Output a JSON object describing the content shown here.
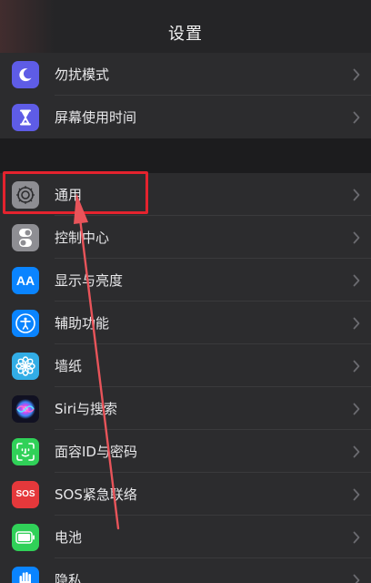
{
  "navbar": {
    "title": "设置"
  },
  "colors": {
    "accent_highlight": "#e4232e",
    "arrow": "#e8545a",
    "background": "#1c1c1e",
    "cell": "#2c2c2e"
  },
  "groups": [
    {
      "items": [
        {
          "label": "勿扰模式",
          "icon": "moon-icon",
          "icon_color": "#5e5ce6"
        },
        {
          "label": "屏幕使用时间",
          "icon": "hourglass-icon",
          "icon_color": "#5e5ce6"
        }
      ]
    },
    {
      "items": [
        {
          "label": "通用",
          "icon": "gear-icon",
          "icon_color": "#8e8e93"
        },
        {
          "label": "控制中心",
          "icon": "toggle-icon",
          "icon_color": "#8e8e93"
        },
        {
          "label": "显示与亮度",
          "icon": "text-size-icon",
          "icon_color": "#0a84ff",
          "icon_text": "AA"
        },
        {
          "label": "辅助功能",
          "icon": "accessibility-icon",
          "icon_color": "#0a84ff"
        },
        {
          "label": "墙纸",
          "icon": "flower-icon",
          "icon_color": "#32ade6"
        },
        {
          "label": "Siri与搜索",
          "icon": "siri-icon",
          "icon_color": "#1a1a2e"
        },
        {
          "label": "面容ID与密码",
          "icon": "face-id-icon",
          "icon_color": "#30d158"
        },
        {
          "label": "SOS紧急联络",
          "icon": "sos-icon",
          "icon_color": "#e5383b",
          "icon_text": "SOS"
        },
        {
          "label": "电池",
          "icon": "battery-icon",
          "icon_color": "#30d158"
        },
        {
          "label": "隐私",
          "icon": "hand-icon",
          "icon_color": "#0a84ff"
        }
      ]
    }
  ]
}
